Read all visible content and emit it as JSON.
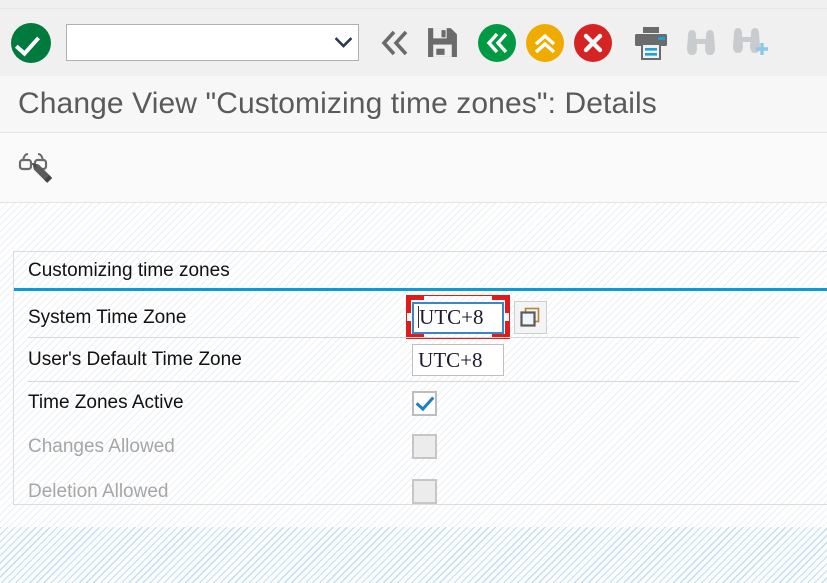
{
  "window": {
    "title": "Change View \"Customizing time zones\": Details"
  },
  "toolbar": {
    "enter_label": "Enter",
    "command_value": "",
    "command_placeholder": "",
    "dropdown_label": "Open command field history",
    "items": [
      {
        "name": "back-icon",
        "label": "Back"
      },
      {
        "name": "save-icon",
        "label": "Save"
      },
      {
        "name": "exit-icon",
        "label": "Exit"
      },
      {
        "name": "cancel-up-icon",
        "label": "Cancel"
      },
      {
        "name": "stop-icon",
        "label": "Stop Transaction"
      },
      {
        "name": "print-icon",
        "label": "Print"
      },
      {
        "name": "find-icon",
        "label": "Find"
      },
      {
        "name": "find-next-icon",
        "label": "Find Next"
      }
    ]
  },
  "app_toolbar": {
    "display_change_label": "Display <-> Change"
  },
  "form": {
    "section_title": "Customizing time zones",
    "rows": [
      {
        "label": "System Time Zone",
        "type": "input",
        "value": "UTC+8",
        "enabled": true,
        "focused": true,
        "annotated": true,
        "has_multi_button": true,
        "multi_button_label": "Multiple selection"
      },
      {
        "label": "User's Default Time Zone",
        "type": "input",
        "value": "UTC+8",
        "enabled": true,
        "focused": false,
        "annotated": false,
        "has_multi_button": false
      },
      {
        "label": "Time Zones Active",
        "type": "checkbox",
        "checked": true,
        "enabled": true
      },
      {
        "label": "Changes Allowed",
        "type": "checkbox",
        "checked": false,
        "enabled": false
      },
      {
        "label": "Deletion Allowed",
        "type": "checkbox",
        "checked": false,
        "enabled": false
      }
    ]
  },
  "colors": {
    "accent_blue": "#0a9bd8",
    "ok_green": "#007a3d",
    "exit_green": "#009a44",
    "cancel_yellow": "#f0ab00",
    "stop_red": "#d62323",
    "annotation_red": "#e01b1b",
    "focus_blue": "#3a86c8",
    "title_grey": "#5a5a5a"
  }
}
